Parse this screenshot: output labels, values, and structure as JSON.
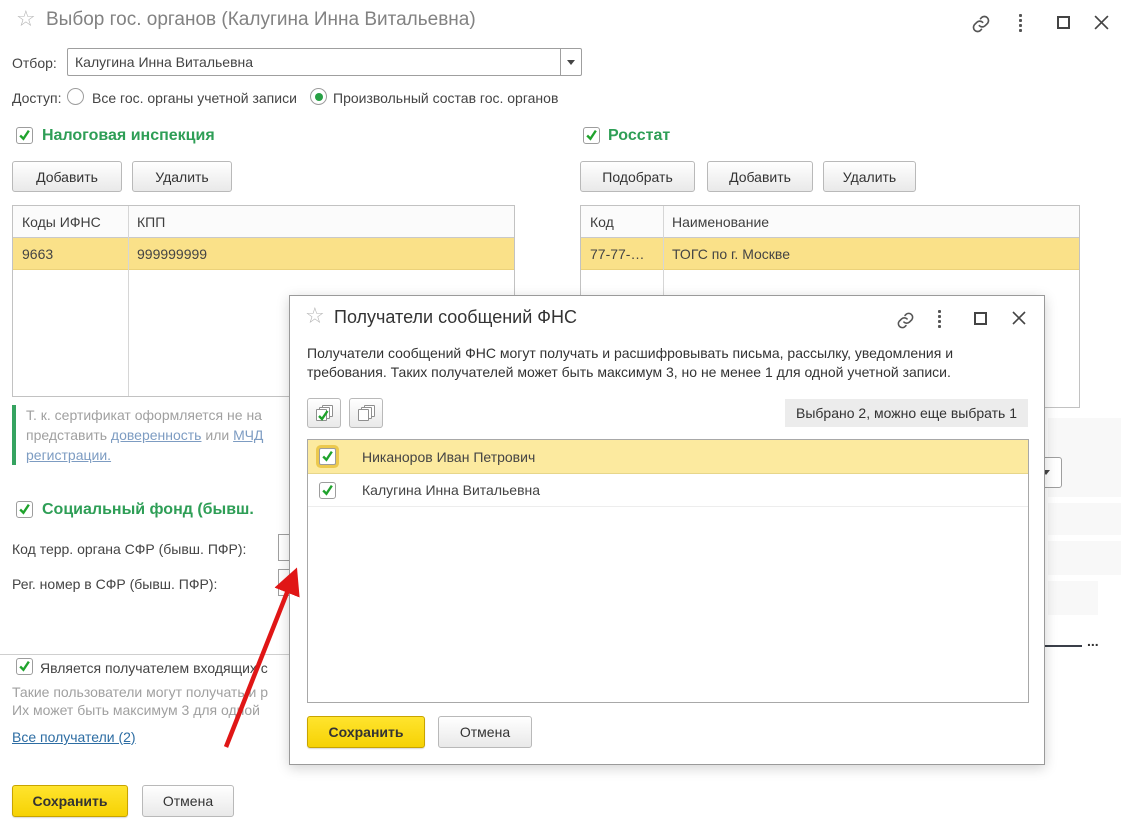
{
  "window": {
    "title": "Выбор гос. органов (Калугина Инна Витальевна)",
    "filter": {
      "label": "Отбор:",
      "value": "Калугина Инна Витальевна"
    },
    "access": {
      "label": "Доступ:",
      "option1": "Все гос. органы учетной записи",
      "option2": "Произвольный состав гос. органов"
    }
  },
  "tax": {
    "title": "Налоговая инспекция",
    "add": "Добавить",
    "remove": "Удалить",
    "col1": "Коды ИФНС",
    "col2": "КПП",
    "row": {
      "code": "9663",
      "kpp": "999999999"
    }
  },
  "rosstat": {
    "title": "Росстат",
    "pick": "Подобрать",
    "add": "Добавить",
    "remove": "Удалить",
    "col1": "Код",
    "col2": "Наименование",
    "row": {
      "code": "77-77-…",
      "name": "ТОГС по г. Москве"
    }
  },
  "notice": {
    "line1": "Т. к. сертификат оформляется не на",
    "line2_part1": "представить ",
    "link_attorney": "доверенность",
    "line2_part2": " или ",
    "link_mchd": "МЧД",
    "link_registration": "регистрации."
  },
  "sfr": {
    "title": "Социальный фонд (бывш.",
    "field1": "Код терр. органа СФР (бывш. ПФР):",
    "field2": "Рег. номер в СФР (бывш. ПФР):"
  },
  "incoming": {
    "checkbox": "Является получателем входящих с",
    "note1": "Такие пользователи могут получать и р",
    "note2": "Их может быть максимум 3 для одной",
    "link": "Все получатели (2)"
  },
  "footer": {
    "save": "Сохранить",
    "cancel": "Отмена"
  },
  "modal": {
    "title": "Получатели сообщений ФНС",
    "desc1": "Получатели сообщений ФНС могут получать и расшифровывать письма, рассылку, уведомления и",
    "desc2": "требования. Таких получателей может быть максимум 3, но не менее 1 для одной учетной записи.",
    "badge": "Выбрано 2, можно еще выбрать 1",
    "item1": "Никаноров Иван Петрович",
    "item2": "Калугина Инна Витальевна",
    "save": "Сохранить",
    "cancel": "Отмена"
  },
  "background": {
    "ellipsis": "..."
  },
  "colors": {
    "accent_green": "#2e9e56",
    "selection_yellow": "#fae189",
    "button_yellow": "#f6d204",
    "link_blue": "#2d6da3",
    "arrow_red": "#e01616"
  }
}
